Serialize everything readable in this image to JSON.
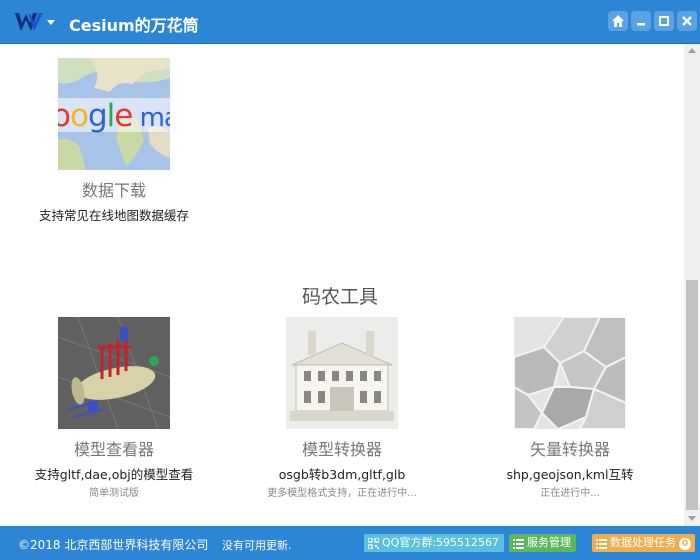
{
  "window": {
    "title": "Cesium的万花筒",
    "logo_icon": "w-logo-icon",
    "buttons": [
      "home-icon",
      "minimize-icon",
      "maximize-icon",
      "close-icon"
    ]
  },
  "top_card": {
    "thumb_text": "oogle map",
    "title": "数据下载",
    "description": "支持常见在线地图数据缓存"
  },
  "section": {
    "heading": "码农工具"
  },
  "tools": [
    {
      "title": "模型查看器",
      "description": "支持gltf,dae,obj的模型查看",
      "note": "简单测试版"
    },
    {
      "title": "模型转换器",
      "description": "osgb转b3dm,gltf,glb",
      "note": "更多模型格式支持，正在进行中..."
    },
    {
      "title": "矢量转换器",
      "description": "shp,geojson,kml互转",
      "note": "正在进行中..."
    }
  ],
  "footer": {
    "copyright": "©2018 北京西部世界科技有限公司",
    "update_status": "没有可用更新.",
    "qq_button": "QQ官方群:595512567",
    "service_button": "服务管理",
    "task_button": "数据处理任务",
    "task_count": "0"
  },
  "colors": {
    "brand_blue": "#2d86d5",
    "qq_button": "#5bc0de",
    "service_button": "#5cb85c",
    "task_button": "#f0ad4e"
  }
}
